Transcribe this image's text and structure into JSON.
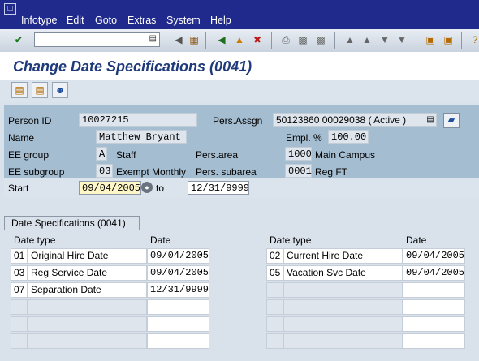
{
  "menu": {
    "items": [
      "Infotype",
      "Edit",
      "Goto",
      "Extras",
      "System",
      "Help"
    ]
  },
  "title": "Change Date Specifications (0041)",
  "header": {
    "person_id_label": "Person ID",
    "person_id": "10027215",
    "pers_assgn_label": "Pers.Assgn",
    "pers_assgn": "50123860 00029038 ( Active )",
    "name_label": "Name",
    "name": "Matthew Bryant",
    "empl_pct_label": "Empl. %",
    "empl_pct": "100.00",
    "ee_group_label": "EE group",
    "ee_group_code": "A",
    "ee_group_text": "Staff",
    "pers_area_label": "Pers.area",
    "pers_area_code": "1000",
    "pers_area_text": "Main Campus",
    "ee_subgroup_label": "EE subgroup",
    "ee_subgroup_code": "03",
    "ee_subgroup_text": "Exempt Monthly",
    "pers_subarea_label": "Pers. subarea",
    "pers_subarea_code": "0001",
    "pers_subarea_text": "Reg FT",
    "start_label": "Start",
    "start": "09/04/2005",
    "to_label": "to",
    "end": "12/31/9999"
  },
  "tab": {
    "label": "Date Specifications (0041)"
  },
  "table": {
    "left": {
      "col_type": "Date type",
      "col_date": "Date",
      "rows": [
        {
          "code": "01",
          "text": "Original Hire Date",
          "date": "09/04/2005"
        },
        {
          "code": "03",
          "text": "Reg Service Date",
          "date": "09/04/2005"
        },
        {
          "code": "07",
          "text": "Separation Date",
          "date": "12/31/9999"
        },
        {
          "code": "",
          "text": "",
          "date": ""
        },
        {
          "code": "",
          "text": "",
          "date": ""
        },
        {
          "code": "",
          "text": "",
          "date": ""
        }
      ]
    },
    "right": {
      "col_type": "Date type",
      "col_date": "Date",
      "rows": [
        {
          "code": "02",
          "text": "Current Hire Date",
          "date": "09/04/2005"
        },
        {
          "code": "05",
          "text": "Vacation Svc Date",
          "date": "09/04/2005"
        },
        {
          "code": "",
          "text": "",
          "date": ""
        },
        {
          "code": "",
          "text": "",
          "date": ""
        },
        {
          "code": "",
          "text": "",
          "date": ""
        },
        {
          "code": "",
          "text": "",
          "date": ""
        }
      ]
    }
  }
}
